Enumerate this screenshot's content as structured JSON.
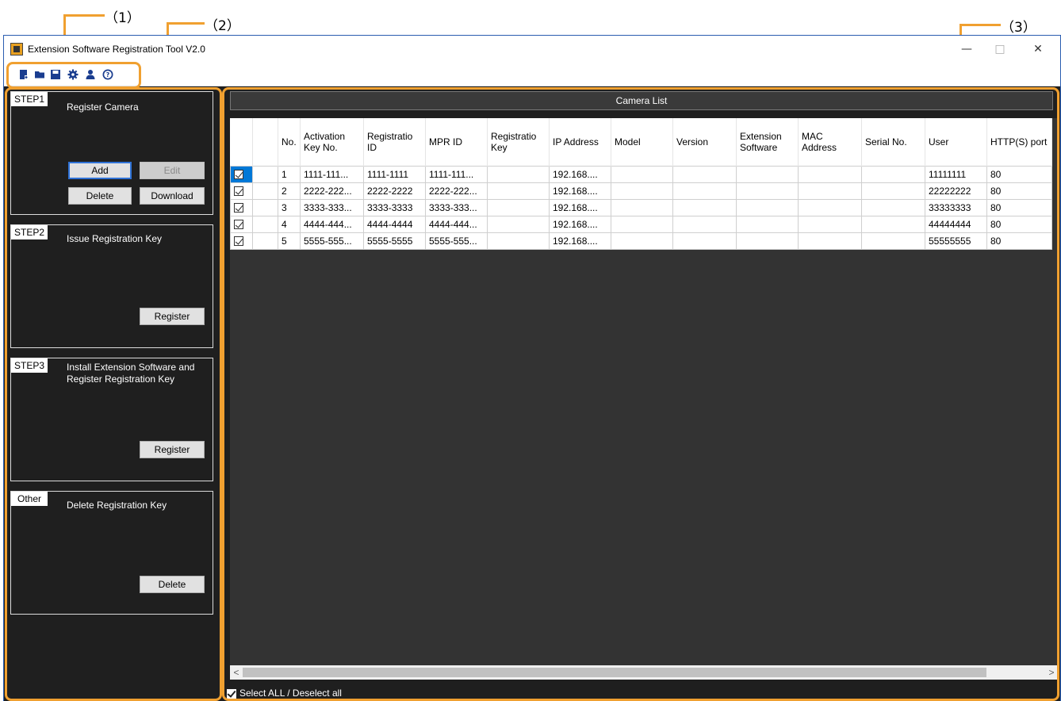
{
  "callouts": {
    "c1": "（1）",
    "c2": "（2）",
    "c3": "（3）"
  },
  "window": {
    "title": "Extension Software Registration Tool V2.0",
    "minimize": "—",
    "maximize": "□",
    "close": "✕"
  },
  "toolbar": {
    "icons": [
      "new-file-icon",
      "open-folder-icon",
      "save-icon",
      "settings-gear-icon",
      "user-icon",
      "help-icon"
    ]
  },
  "steps": [
    {
      "tag": "STEP1",
      "title": "Register Camera",
      "buttons": [
        "Add",
        "Edit",
        "Delete",
        "Download"
      ]
    },
    {
      "tag": "STEP2",
      "title": "Issue Registration Key",
      "buttons": [
        "Register"
      ]
    },
    {
      "tag": "STEP3",
      "title": "Install Extension Software and Register Registration Key",
      "buttons": [
        "Register"
      ]
    },
    {
      "tag": "Other",
      "title": "Delete Registration Key",
      "buttons": [
        "Delete"
      ]
    }
  ],
  "camera_list": {
    "header": "Camera List",
    "columns": [
      "",
      "",
      "No.",
      "Activation Key No.",
      "Registratio ID",
      "MPR ID",
      "Registratio Key",
      "IP Address",
      "Model",
      "Version",
      "Extension Software",
      "MAC Address",
      "Serial No.",
      "User",
      "HTTP(S) port"
    ],
    "rows": [
      [
        "1",
        "1111-111...",
        "1111-1111",
        "1111-111...",
        "",
        "192.168....",
        "",
        "",
        "",
        "",
        "",
        "11111111",
        "80"
      ],
      [
        "2",
        "2222-222...",
        "2222-2222",
        "2222-222...",
        "",
        "192.168....",
        "",
        "",
        "",
        "",
        "",
        "22222222",
        "80"
      ],
      [
        "3",
        "3333-333...",
        "3333-3333",
        "3333-333...",
        "",
        "192.168....",
        "",
        "",
        "",
        "",
        "",
        "33333333",
        "80"
      ],
      [
        "4",
        "4444-444...",
        "4444-4444",
        "4444-444...",
        "",
        "192.168....",
        "",
        "",
        "",
        "",
        "",
        "44444444",
        "80"
      ],
      [
        "5",
        "5555-555...",
        "5555-5555",
        "5555-555...",
        "",
        "192.168....",
        "",
        "",
        "",
        "",
        "",
        "55555555",
        "80"
      ]
    ],
    "scroll_left": "<",
    "scroll_right": ">",
    "select_all": "Select ALL / Deselect all"
  },
  "colors": {
    "highlight": "#f0a030",
    "panel_bg": "#1f1f1f",
    "selection": "#0078d7"
  }
}
